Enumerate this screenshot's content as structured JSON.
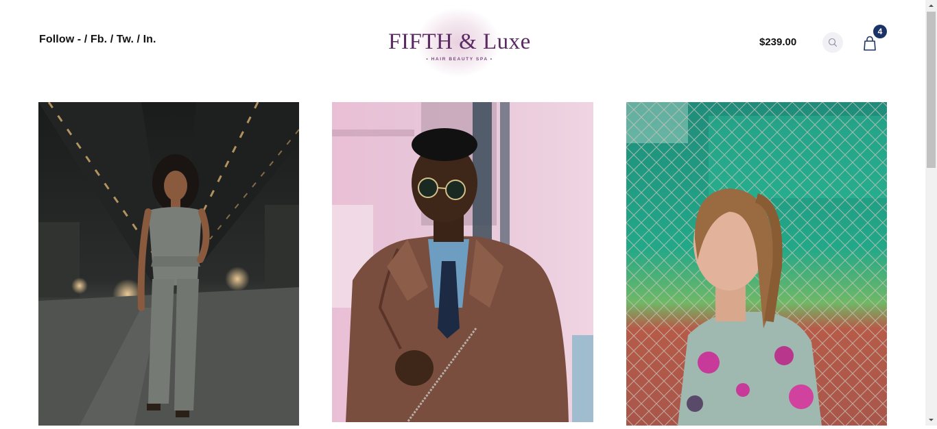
{
  "header": {
    "follow_label": "Follow -",
    "social": [
      {
        "label": "/ Fb."
      },
      {
        "label": "/ Tw."
      },
      {
        "label": "/ In."
      }
    ],
    "logo": {
      "name": "FIFTH & Luxe",
      "tagline": "• HAIR BEAUTY SPA •",
      "color": "#5a2a63"
    },
    "cart_total": "$239.00",
    "cart_count": "4",
    "icons": {
      "search": "search-icon",
      "cart": "shopping-bag-icon"
    },
    "badge_color": "#1c3367"
  },
  "gallery": {
    "items": [
      {
        "subject": "woman-in-grey-jumpsuit"
      },
      {
        "subject": "man-in-leather-jacket-and-sunglasses"
      },
      {
        "subject": "woman-by-chain-link-fence"
      }
    ]
  }
}
